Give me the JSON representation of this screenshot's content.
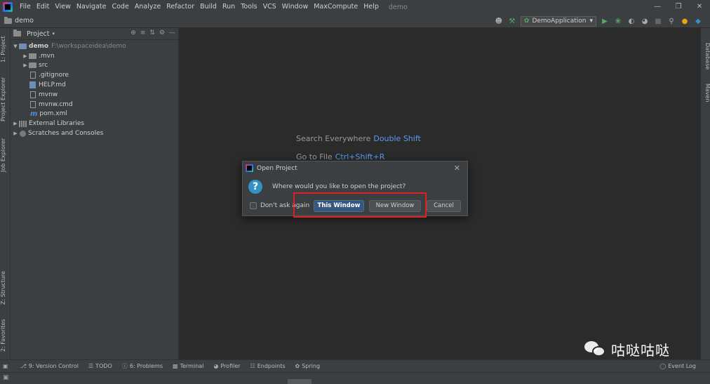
{
  "menu": [
    "File",
    "Edit",
    "View",
    "Navigate",
    "Code",
    "Analyze",
    "Refactor",
    "Build",
    "Run",
    "Tools",
    "VCS",
    "Window",
    "MaxCompute",
    "Help"
  ],
  "window_title": "demo",
  "breadcrumb": "demo",
  "run_config": "DemoApplication",
  "left_tabs": {
    "project": "1: Project",
    "project_explorer": "Project Explorer",
    "job_explorer": "Job Explorer",
    "structure": "Z: Structure",
    "favorites": "2: Favorites"
  },
  "right_tabs": {
    "database": "Database",
    "maven": "Maven"
  },
  "project_panel": {
    "title": "Project",
    "root": {
      "name": "demo",
      "path": "F:\\workspaceidea\\demo"
    },
    "items": [
      ".mvn",
      "src",
      ".gitignore",
      "HELP.md",
      "mvnw",
      "mvnw.cmd",
      "pom.xml"
    ],
    "external_libraries": "External Libraries",
    "scratches": "Scratches and Consoles"
  },
  "editor_hints": {
    "search_label": "Search Everywhere",
    "search_key": "Double Shift",
    "goto_label": "Go to File",
    "goto_key": "Ctrl+Shift+R"
  },
  "dialog": {
    "title": "Open Project",
    "message": "Where would you like to open the project?",
    "dont_ask": "Don't ask again",
    "this_window": "This Window",
    "new_window": "New Window",
    "cancel": "Cancel"
  },
  "bottom_tabs": [
    "9: Version Control",
    "TODO",
    "6: Problems",
    "Terminal",
    "Profiler",
    "Endpoints",
    "Spring"
  ],
  "event_log": "Event Log",
  "watermark": "咕哒咕哒",
  "colors": {
    "accent": "#589df6",
    "primary_button": "#365880",
    "highlight_box": "#e02020",
    "background": "#2b2b2b"
  }
}
